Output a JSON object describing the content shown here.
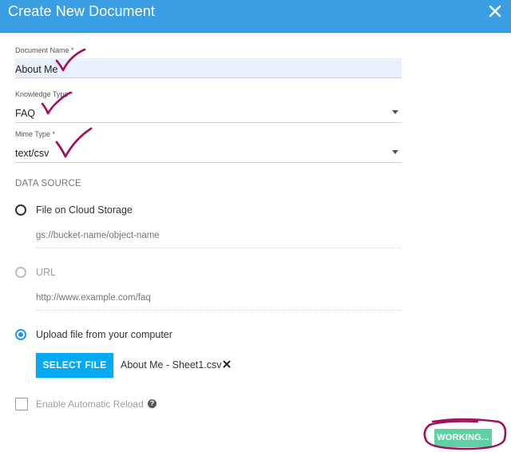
{
  "dialog": {
    "title": "Create New Document",
    "close_icon": "close-icon"
  },
  "form": {
    "document_name": {
      "label": "Document Name *",
      "value": "About Me"
    },
    "knowledge_type": {
      "label": "Knowledge Type *",
      "value": "FAQ"
    },
    "mime_type": {
      "label": "Mime Type *",
      "value": "text/csv"
    },
    "data_source": {
      "title": "DATA SOURCE",
      "options": [
        {
          "label": "File on Cloud Storage",
          "placeholder": "gs://bucket-name/object-name",
          "selected": false,
          "disabled": false
        },
        {
          "label": "URL",
          "placeholder": "http://www.example.com/faq",
          "selected": false,
          "disabled": true
        },
        {
          "label": "Upload file from your computer",
          "selected": true,
          "disabled": false
        }
      ],
      "select_file_label": "SELECT FILE",
      "file_name": "About Me - Sheet1.csv"
    },
    "auto_reload": {
      "label": "Enable Automatic Reload",
      "checked": false,
      "disabled": true
    }
  },
  "actions": {
    "primary_label": "WORKING..."
  },
  "colors": {
    "header": "#3a9ee3",
    "accent": "#2196f3",
    "select_button": "#03a9f4",
    "working_button": "#5ed1a3",
    "annotation": "#a0125e"
  }
}
